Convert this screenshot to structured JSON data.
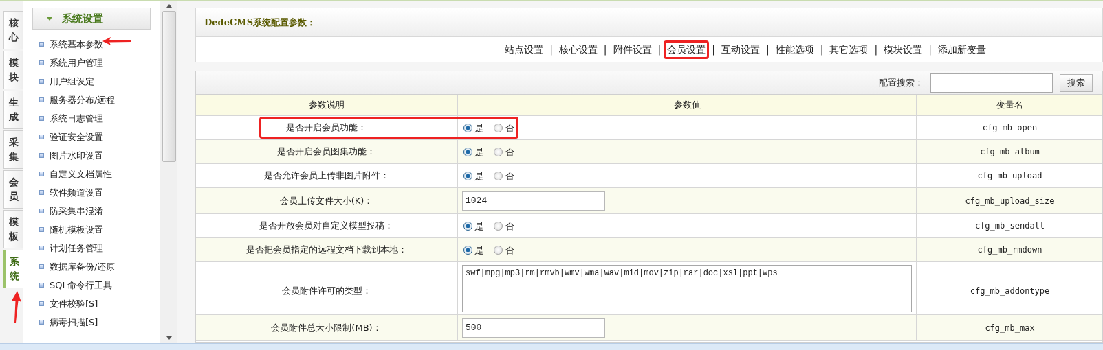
{
  "side_tabs": [
    {
      "label": "核心",
      "selected": false,
      "arrow": false
    },
    {
      "label": "模块",
      "selected": false,
      "arrow": false
    },
    {
      "label": "生成",
      "selected": false,
      "arrow": false
    },
    {
      "label": "采集",
      "selected": false,
      "arrow": false
    },
    {
      "label": "会员",
      "selected": false,
      "arrow": false
    },
    {
      "label": "模板",
      "selected": false,
      "arrow": false
    },
    {
      "label": "系统",
      "selected": true,
      "arrow": true
    }
  ],
  "menu": {
    "title": "系统设置",
    "items": [
      {
        "label": "系统基本参数",
        "arrow": true
      },
      {
        "label": "系统用户管理",
        "arrow": false
      },
      {
        "label": "用户组设定",
        "arrow": false
      },
      {
        "label": "服务器分布/远程",
        "arrow": false
      },
      {
        "label": "系统日志管理",
        "arrow": false
      },
      {
        "label": "验证安全设置",
        "arrow": false
      },
      {
        "label": "图片水印设置",
        "arrow": false
      },
      {
        "label": "自定义文档属性",
        "arrow": false
      },
      {
        "label": "软件频道设置",
        "arrow": false
      },
      {
        "label": "防采集串混淆",
        "arrow": false
      },
      {
        "label": "随机模板设置",
        "arrow": false
      },
      {
        "label": "计划任务管理",
        "arrow": false
      },
      {
        "label": "数据库备份/还原",
        "arrow": false
      },
      {
        "label": "SQL命令行工具",
        "arrow": false
      },
      {
        "label": "文件校验[S]",
        "arrow": false
      },
      {
        "label": "病毒扫描[S]",
        "arrow": false
      }
    ]
  },
  "header": {
    "title": "DedeCMS系统配置参数："
  },
  "nav": {
    "items": [
      {
        "label": "站点设置",
        "circled": false
      },
      {
        "label": "核心设置",
        "circled": false
      },
      {
        "label": "附件设置",
        "circled": false
      },
      {
        "label": "会员设置",
        "circled": true
      },
      {
        "label": "互动设置",
        "circled": false
      },
      {
        "label": "性能选项",
        "circled": false
      },
      {
        "label": "其它选项",
        "circled": false
      },
      {
        "label": "模块设置",
        "circled": false
      },
      {
        "label": "添加新变量",
        "circled": false
      }
    ],
    "separators": [
      "|",
      "|",
      "|",
      "|",
      "|",
      "|",
      "|",
      "|"
    ]
  },
  "search": {
    "label": "配置搜索：",
    "button": "搜索"
  },
  "table": {
    "columns": [
      "参数说明",
      "参数值",
      "变量名"
    ],
    "rows": [
      {
        "label": "是否开启会员功能：",
        "kind": "radio",
        "options": [
          {
            "label": "是",
            "selected": true
          },
          {
            "label": "否",
            "selected": false
          }
        ],
        "var": "cfg_mb_open",
        "circled": true
      },
      {
        "label": "是否开启会员图集功能：",
        "kind": "radio",
        "options": [
          {
            "label": "是",
            "selected": true
          },
          {
            "label": "否",
            "selected": false
          }
        ],
        "var": "cfg_mb_album",
        "circled": false
      },
      {
        "label": "是否允许会员上传非图片附件：",
        "kind": "radio",
        "options": [
          {
            "label": "是",
            "selected": true
          },
          {
            "label": "否",
            "selected": false
          }
        ],
        "var": "cfg_mb_upload",
        "circled": false
      },
      {
        "label": "会员上传文件大小(K)：",
        "kind": "text",
        "value": "1024",
        "var": "cfg_mb_upload_size",
        "circled": false
      },
      {
        "label": "是否开放会员对自定义模型投稿：",
        "kind": "radio",
        "options": [
          {
            "label": "是",
            "selected": true
          },
          {
            "label": "否",
            "selected": false
          }
        ],
        "var": "cfg_mb_sendall",
        "circled": false
      },
      {
        "label": "是否把会员指定的远程文档下载到本地：",
        "kind": "radio",
        "options": [
          {
            "label": "是",
            "selected": true
          },
          {
            "label": "否",
            "selected": false
          }
        ],
        "var": "cfg_mb_rmdown",
        "circled": false
      },
      {
        "label": "会员附件许可的类型：",
        "kind": "textarea",
        "value": "swf|mpg|mp3|rm|rmvb|wmv|wma|wav|mid|mov|zip|rar|doc|xsl|ppt|wps",
        "var": "cfg_mb_addontype",
        "circled": false
      },
      {
        "label": "会员附件总大小限制(MB)：",
        "kind": "text",
        "value": "500",
        "var": "cfg_mb_max",
        "circled": false
      }
    ]
  }
}
